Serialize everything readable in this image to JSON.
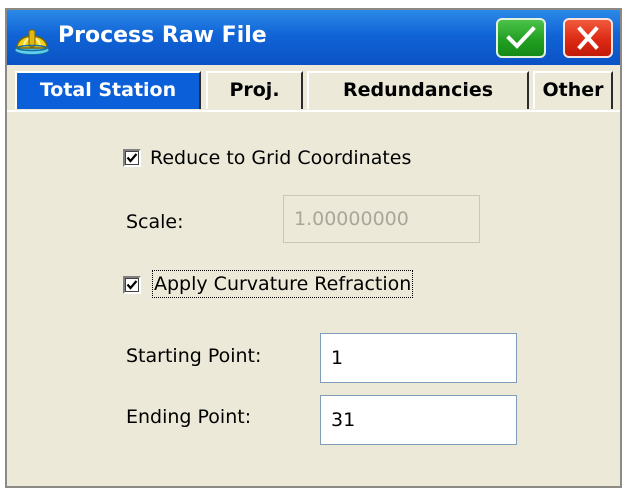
{
  "window": {
    "title": "Process Raw File",
    "icon": "hard-hat-app-icon",
    "ok_icon": "checkmark-icon",
    "close_icon": "close-x-icon",
    "colors": {
      "titlebar": "#0a52c6",
      "ok_button": "#22a023",
      "close_button": "#dd2a14",
      "face": "#ece9d8"
    }
  },
  "tabs": [
    {
      "label": "Total Station",
      "active": true
    },
    {
      "label": "Proj.",
      "active": false
    },
    {
      "label": "Redundancies",
      "active": false
    },
    {
      "label": "Other",
      "active": false
    }
  ],
  "form": {
    "reduce_grid": {
      "label": "Reduce to Grid Coordinates",
      "checked": true
    },
    "scale": {
      "label": "Scale:",
      "value": "1.00000000",
      "enabled": false
    },
    "curvature": {
      "label": "Apply Curvature Refraction",
      "checked": true
    },
    "starting_point": {
      "label": "Starting Point:",
      "value": "1"
    },
    "ending_point": {
      "label": "Ending Point:",
      "value": "31"
    }
  }
}
